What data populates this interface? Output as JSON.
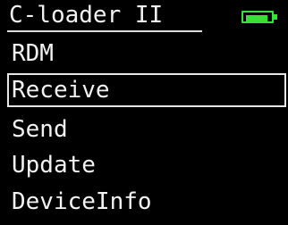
{
  "title": "C-loader II",
  "battery": {
    "icon": "battery-icon",
    "level": 0.8,
    "color": "#34e03a"
  },
  "menu": {
    "selected_index": 1,
    "items": [
      {
        "label": "RDM"
      },
      {
        "label": "Receive"
      },
      {
        "label": "Send"
      },
      {
        "label": "Update"
      },
      {
        "label": "DeviceInfo"
      }
    ]
  }
}
